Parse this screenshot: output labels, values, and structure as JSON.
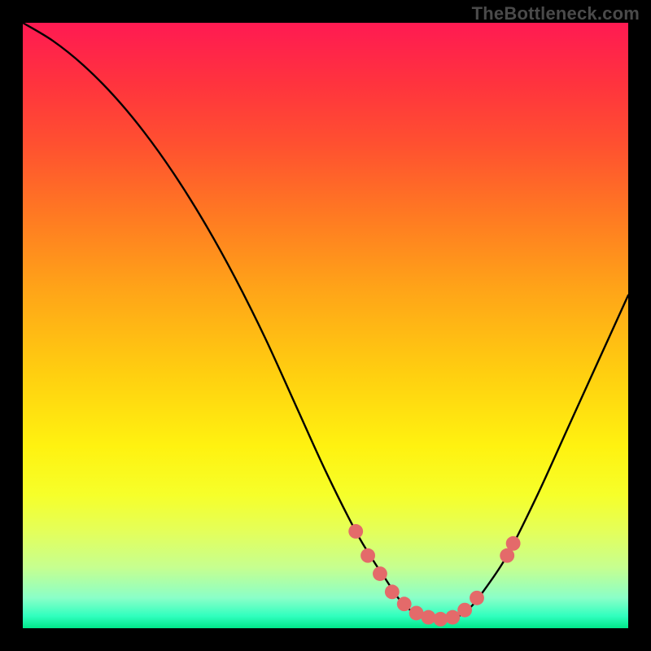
{
  "attribution": "TheBottleneck.com",
  "chart_data": {
    "type": "line",
    "title": "",
    "xlabel": "",
    "ylabel": "",
    "xlim": [
      0,
      100
    ],
    "ylim": [
      0,
      100
    ],
    "grid": false,
    "legend": false,
    "series": [
      {
        "name": "bottleneck-curve",
        "color": "#000000",
        "x": [
          0,
          5,
          10,
          15,
          20,
          25,
          30,
          35,
          40,
          45,
          50,
          55,
          58,
          60,
          62,
          64,
          66,
          68,
          70,
          72,
          74,
          76,
          80,
          85,
          90,
          95,
          100
        ],
        "y": [
          100,
          97,
          93,
          88,
          82,
          75,
          67,
          58,
          48,
          37,
          26,
          16,
          11,
          8,
          5,
          3,
          2,
          1.5,
          1.5,
          2,
          3.5,
          6,
          12,
          22,
          33,
          44,
          55
        ]
      }
    ],
    "markers": {
      "name": "highlight-points",
      "color": "#e46a6a",
      "radius_pct": 1.2,
      "x": [
        55,
        57,
        59,
        61,
        63,
        65,
        67,
        69,
        71,
        73,
        75,
        80,
        81
      ],
      "y": [
        16,
        12,
        9,
        6,
        4,
        2.5,
        1.8,
        1.5,
        1.8,
        3,
        5,
        12,
        14
      ]
    }
  }
}
